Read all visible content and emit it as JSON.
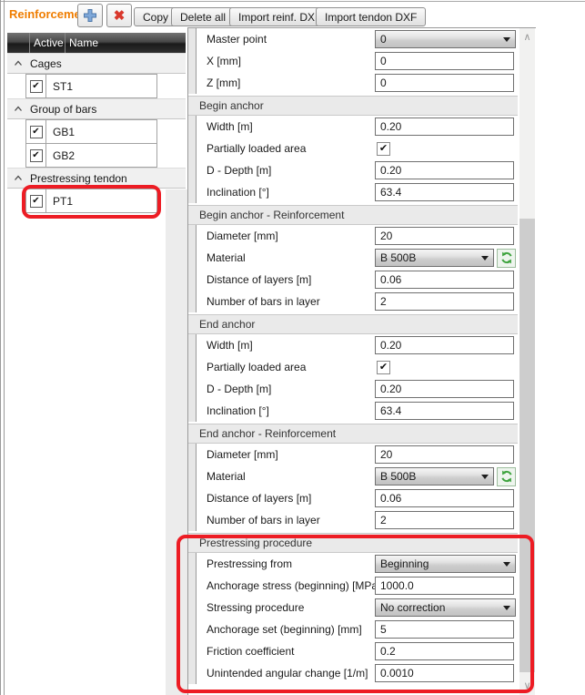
{
  "toolbar": {
    "title": "Reinforcement",
    "copy": "Copy",
    "delete_all": "Delete all",
    "import_reinf_dxf": "Import reinf. DXF",
    "import_tendon_dxf": "Import tendon DXF"
  },
  "tree": {
    "header": {
      "active": "Active",
      "name": "Name"
    },
    "groups": [
      {
        "label": "Cages",
        "items": [
          {
            "name": "ST1",
            "active": true,
            "annotated": false
          }
        ]
      },
      {
        "label": "Group of bars",
        "items": [
          {
            "name": "GB1",
            "active": true,
            "annotated": false
          },
          {
            "name": "GB2",
            "active": true,
            "annotated": false
          }
        ]
      },
      {
        "label": "Prestressing tendon",
        "items": [
          {
            "name": "PT1",
            "active": true,
            "annotated": true
          }
        ]
      }
    ]
  },
  "properties": {
    "rows": [
      {
        "type": "combo",
        "label": "Master point",
        "value": "0"
      },
      {
        "type": "field",
        "label": "X [mm]",
        "value": "0"
      },
      {
        "type": "field",
        "label": "Z [mm]",
        "value": "0"
      },
      {
        "type": "section",
        "label": "Begin anchor"
      },
      {
        "type": "field",
        "label": "Width [m]",
        "value": "0.20"
      },
      {
        "type": "check",
        "label": "Partially loaded area",
        "checked": true
      },
      {
        "type": "field",
        "label": "D - Depth [m]",
        "value": "0.20"
      },
      {
        "type": "field",
        "label": "Inclination [°]",
        "value": "63.4"
      },
      {
        "type": "section",
        "label": "Begin anchor - Reinforcement"
      },
      {
        "type": "field",
        "label": "Diameter [mm]",
        "value": "20"
      },
      {
        "type": "combo",
        "label": "Material",
        "value": "B 500B",
        "refresh": true
      },
      {
        "type": "field",
        "label": "Distance of layers [m]",
        "value": "0.06"
      },
      {
        "type": "field",
        "label": "Number of bars in layer",
        "value": "2"
      },
      {
        "type": "section",
        "label": "End anchor"
      },
      {
        "type": "field",
        "label": "Width [m]",
        "value": "0.20"
      },
      {
        "type": "check",
        "label": "Partially loaded area",
        "checked": true
      },
      {
        "type": "field",
        "label": "D - Depth [m]",
        "value": "0.20"
      },
      {
        "type": "field",
        "label": "Inclination [°]",
        "value": "63.4"
      },
      {
        "type": "section",
        "label": "End anchor - Reinforcement"
      },
      {
        "type": "field",
        "label": "Diameter [mm]",
        "value": "20"
      },
      {
        "type": "combo",
        "label": "Material",
        "value": "B 500B",
        "refresh": true
      },
      {
        "type": "field",
        "label": "Distance of layers [m]",
        "value": "0.06"
      },
      {
        "type": "field",
        "label": "Number of bars in layer",
        "value": "2"
      },
      {
        "type": "section",
        "label": "Prestressing procedure",
        "annotated": true
      },
      {
        "type": "combo",
        "label": "Prestressing from",
        "value": "Beginning"
      },
      {
        "type": "field",
        "label": "Anchorage stress (beginning) [MPa]",
        "value": "1000.0"
      },
      {
        "type": "combo",
        "label": "Stressing procedure",
        "value": "No correction"
      },
      {
        "type": "field",
        "label": "Anchorage set (beginning) [mm]",
        "value": "5"
      },
      {
        "type": "field",
        "label": "Friction coefficient",
        "value": "0.2"
      },
      {
        "type": "field",
        "label": "Unintended angular change [1/m]",
        "value": "0.0010"
      }
    ]
  },
  "icons": {
    "add": "plus-icon",
    "delete": "cross-icon",
    "refresh": "circular-arrows-icon",
    "collapse": "chevron-up-icon",
    "combo_arrow": "triangle-down-icon",
    "check_glyph": "✔",
    "delete_glyph": "✖",
    "scroll_up_glyph": "∧",
    "scroll_down_glyph": "∨"
  },
  "colors": {
    "accent": "#ef7d00",
    "annotation": "#ed1c24",
    "refresh_green": "#3fa43f",
    "add_blue": "#7fa8d9",
    "add_blue_edge": "#4f79aa",
    "delete_red": "#d9382c"
  }
}
